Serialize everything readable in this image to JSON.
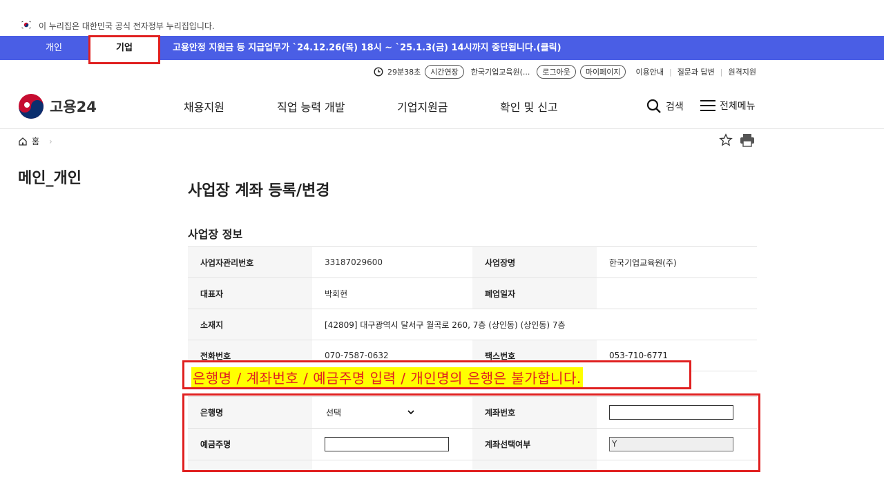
{
  "gov_notice": "이 누리집은 대한민국 공식 전자정부 누리집입니다.",
  "top_tabs": {
    "personal": "개인",
    "business": "기업"
  },
  "notice_banner": "고용안정 지원금 등 지급업무가 `24.12.26(목) 18시 ~ `25.1.3(금) 14시까지 중단됩니다.(클릭)",
  "utility": {
    "session_time": "29분38초",
    "extend_label": "시간연장",
    "org_name": "한국기업교육원(...",
    "logout_label": "로그아웃",
    "mypage_label": "마이페이지",
    "links": [
      "이용안내",
      "질문과 답변",
      "원격지원"
    ]
  },
  "logo_text": "고용24",
  "gnb": [
    "채용지원",
    "직업 능력 개발",
    "기업지원금",
    "확인 및 신고"
  ],
  "search_label": "검색",
  "all_menu_label": "전체메뉴",
  "breadcrumb": {
    "home": "홈"
  },
  "side_title": "메인_개인",
  "page_title": "사업장 계좌 등록/변경",
  "section_title": "사업장 정보",
  "info": {
    "mgmt_no_label": "사업자관리번호",
    "mgmt_no": "33187029600",
    "biz_name_label": "사업장명",
    "biz_name": "한국기업교육원(주)",
    "ceo_label": "대표자",
    "ceo": "박회현",
    "closed_label": "폐업일자",
    "closed": "",
    "address_label": "소재지",
    "address": "[42809] 대구광역시 달서구 월곡로 260, 7층 (상인동) (상인동) 7층",
    "phone_label": "전화번호",
    "phone": "070-7587-0632",
    "fax_label": "팩스번호",
    "fax": "053-710-6771"
  },
  "callout": "은행명 / 계좌번호 / 예금주명 입력 / 개인명의 은행은 불가합니다.",
  "form": {
    "bank_label": "은행명",
    "bank_value": "선택",
    "account_label": "계좌번호",
    "account_value": "",
    "holder_label": "예금주명",
    "holder_value": "",
    "select_label": "계좌선택여부",
    "select_value": "Y"
  },
  "colors": {
    "brand_blue": "#4a5ee5",
    "annotation_red": "#e02020",
    "highlight_yellow": "#ffff00"
  }
}
